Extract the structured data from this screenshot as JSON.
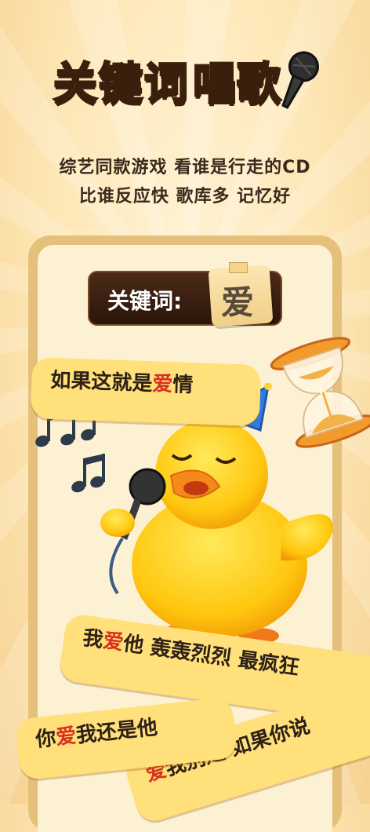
{
  "title": {
    "part1": "关键词",
    "part2": "唱歌"
  },
  "subtitle": {
    "line1": "综艺同款游戏 看谁是行走的CD",
    "line2": "比谁反应快 歌库多 记忆好"
  },
  "keyword": {
    "label": "关键词:",
    "word": "爱"
  },
  "lyrics": [
    {
      "pre": "如果这就是",
      "hl": "爱",
      "post": "情"
    },
    {
      "pre": "我",
      "hl": "爱",
      "post": "他 轰轰烈烈 最疯狂"
    },
    {
      "pre": "你",
      "hl": "爱",
      "post": "我还是他"
    },
    {
      "pre": "",
      "hl": "爱",
      "post": "我别走 如果你说"
    }
  ],
  "colors": {
    "accent": "#ffc21f",
    "highlight": "#d9301f",
    "bubble": "#ffe07a",
    "dark": "#3a1f0c"
  },
  "icons": [
    "microphone-icon",
    "hourglass-icon",
    "music-note-icon",
    "duck-mascot"
  ]
}
